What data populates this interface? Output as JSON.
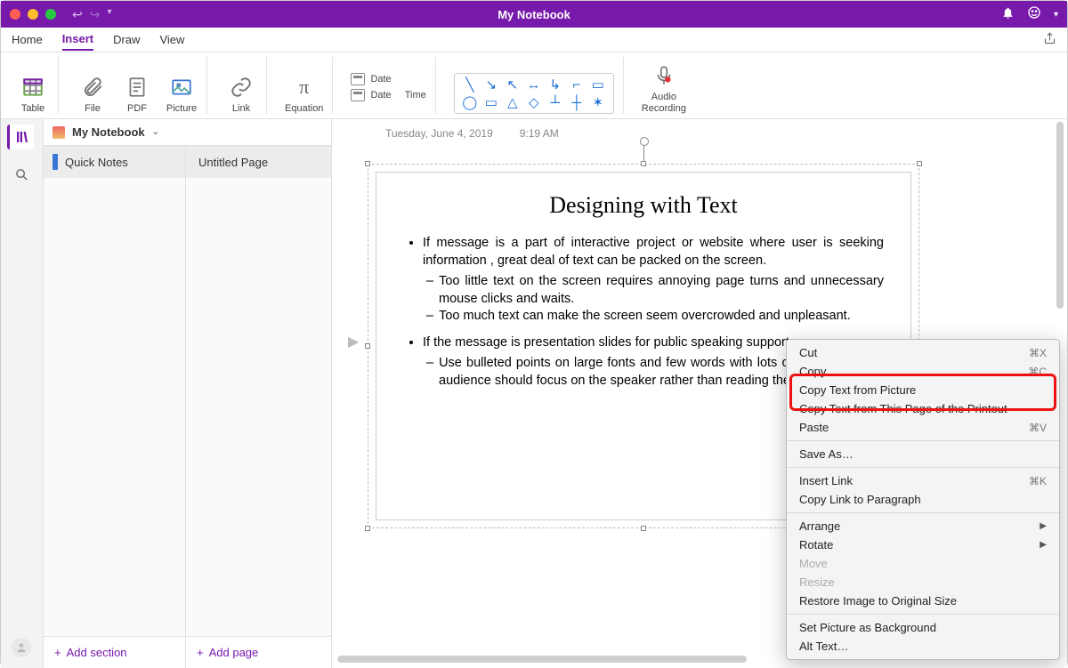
{
  "titlebar": {
    "title": "My Notebook"
  },
  "menu": {
    "home": "Home",
    "insert": "Insert",
    "draw": "Draw",
    "view": "View"
  },
  "ribbon": {
    "table": "Table",
    "file": "File",
    "pdf": "PDF",
    "picture": "Picture",
    "link": "Link",
    "equation": "Equation",
    "date": "Date",
    "datetime_date": "Date",
    "datetime_time": "Time",
    "audio1": "Audio",
    "audio2": "Recording"
  },
  "notebook": {
    "name": "My Notebook",
    "section": "Quick Notes",
    "page": "Untitled Page",
    "add_section": "Add section",
    "add_page": "Add page"
  },
  "page_meta": {
    "date": "Tuesday, June 4, 2019",
    "time": "9:19 AM"
  },
  "document": {
    "title": "Designing with Text",
    "b1": "If message is a part of interactive project  or website where user is seeking information , great deal of text can be packed on the screen.",
    "b1a": "Too little text on the screen requires annoying page turns and unnecessary mouse clicks and waits.",
    "b1b": "Too much text can make the screen seem overcrowded and unpleasant.",
    "b2": "If the message is presentation slides for public speaking support",
    "b2a": "Use bulleted points on large fonts and few words with lots of white space — audience should focus on the speaker rather than reading the slides."
  },
  "ctx": {
    "cut": "Cut",
    "cut_k": "⌘X",
    "copy": "Copy",
    "copy_k": "⌘C",
    "copy_text_picture": "Copy Text from Picture",
    "copy_text_page": "Copy Text from This Page of the Printout",
    "paste": "Paste",
    "paste_k": "⌘V",
    "saveas": "Save As…",
    "insert_link": "Insert Link",
    "insert_link_k": "⌘K",
    "copy_link_para": "Copy Link to Paragraph",
    "arrange": "Arrange",
    "rotate": "Rotate",
    "move": "Move",
    "resize": "Resize",
    "restore": "Restore Image to Original Size",
    "set_bg": "Set Picture as Background",
    "alt_text": "Alt Text…"
  }
}
